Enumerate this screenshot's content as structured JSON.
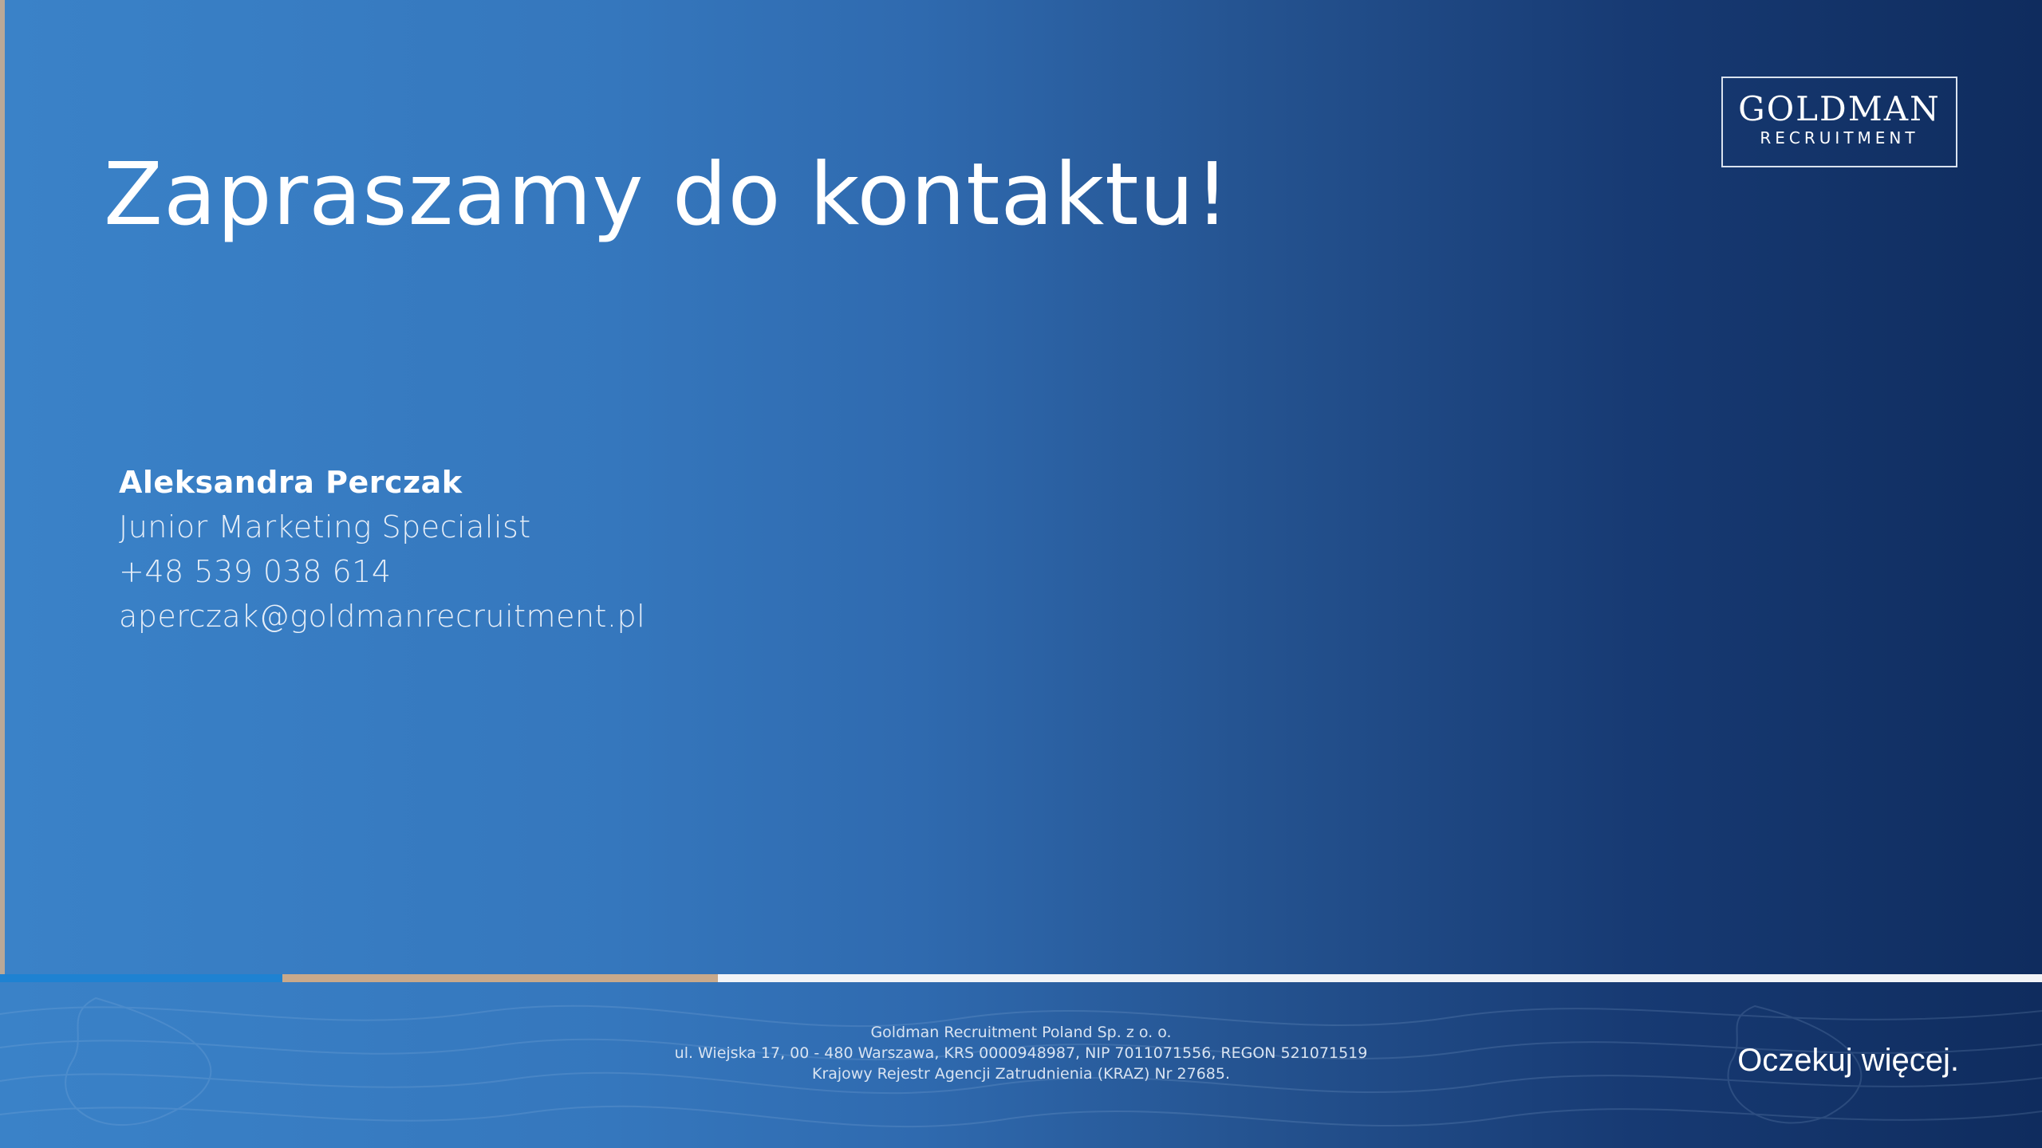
{
  "slide": {
    "title": "Zapraszamy do kontaktu!",
    "logo": {
      "main": "GOLDMAN",
      "sub": "RECRUITMENT"
    },
    "contact": {
      "name": "Aleksandra Perczak",
      "role": "Junior Marketing Specialist",
      "phone": "+48 539 038 614",
      "email": "aperczak@goldmanrecruitment.pl"
    },
    "footer": {
      "company": "Goldman Recruitment Poland Sp. z o. o.",
      "address": "ul. Wiejska 17, 00 - 480 Warszawa, KRS 0000948987, NIP 7011071556, REGON 521071519",
      "registry": "Krajowy Rejestr Agencji Zatrudnienia (KRAZ) Nr 27685.",
      "tagline": "Oczekuj więcej."
    }
  },
  "colors": {
    "gradient_start": "#3a82c8",
    "gradient_end": "#0f2c5e",
    "stripe_blue": "#1e82d2",
    "stripe_tan": "#c8a98b",
    "stripe_white": "#f2f4f7"
  }
}
